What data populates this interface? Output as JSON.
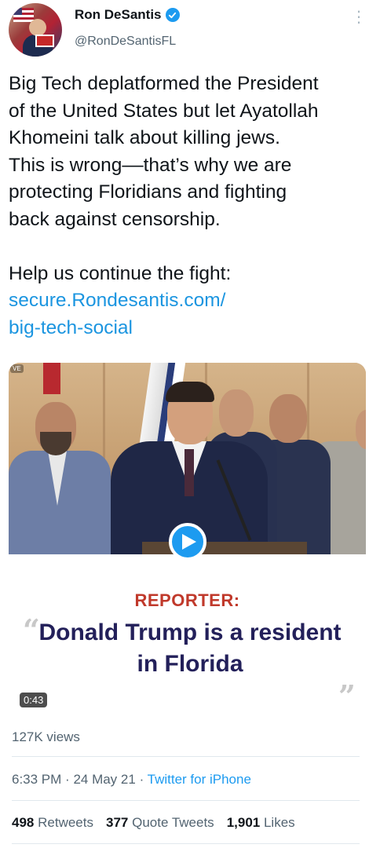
{
  "author": {
    "name": "Ron DeSantis",
    "handle": "@RonDeSantisFL",
    "verified": true
  },
  "tweet": {
    "paragraph1": "Big Tech deplatformed the President\nof the United States but let Ayatollah\nKhomeini talk about killing jews.\nThis is wrong––that’s why we are\nprotecting Floridians and fighting\nback against censorship.",
    "paragraph2": "Help us continue the fight:",
    "link_line1": "secure.Rondesantis.com/",
    "link_line2": "big-tech-social"
  },
  "media": {
    "caption_label": "REPORTER:",
    "quote_text": "Donald Trump is a resident in Florida",
    "duration": "0:43",
    "corner_tag": "VE"
  },
  "views": "127K views",
  "meta": {
    "time": "6:33 PM",
    "date": "24 May 21",
    "source": "Twitter for iPhone"
  },
  "stats": {
    "retweets_count": "498",
    "retweets_label": "Retweets",
    "quotes_count": "377",
    "quotes_label": "Quote Tweets",
    "likes_count": "1,901",
    "likes_label": "Likes"
  },
  "colors": {
    "accent": "#1d9bf0",
    "reporter_red": "#c0392b",
    "quote_navy": "#23205a"
  }
}
